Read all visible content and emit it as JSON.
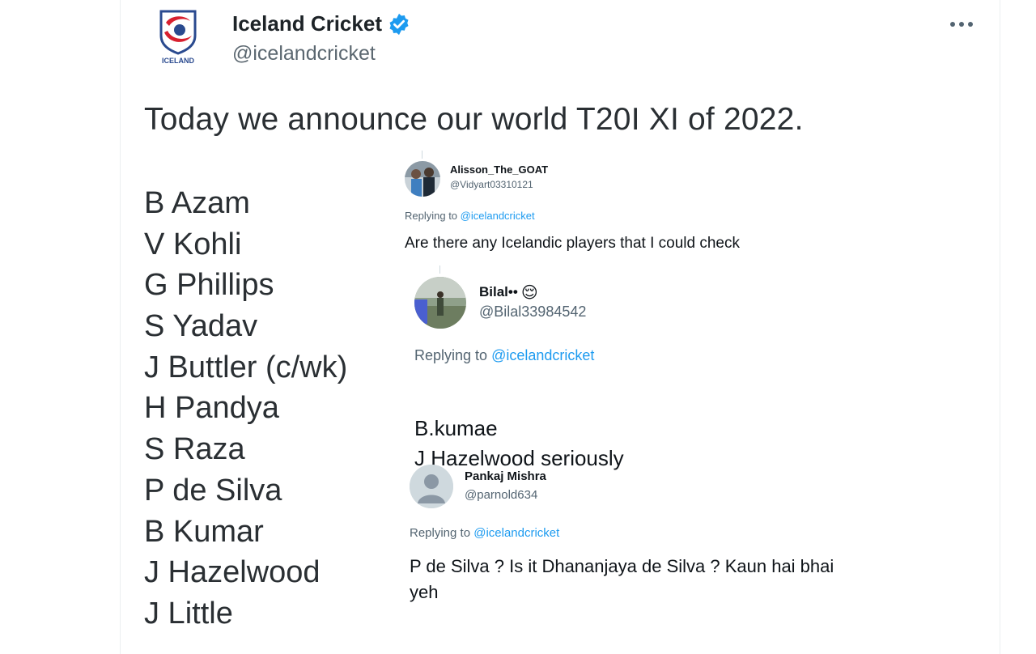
{
  "tweet": {
    "display_name": "Iceland Cricket",
    "handle": "@icelandcricket",
    "logo_text": "ICELAND",
    "text": "Today we announce our world T20I XI of 2022.",
    "players": [
      "B Azam",
      "V Kohli",
      "G Phillips",
      "S Yadav",
      "J Buttler (c/wk)",
      "H Pandya",
      "S Raza",
      "P de Silva",
      "B Kumar",
      "J Hazelwood",
      "J Little"
    ]
  },
  "replies": [
    {
      "name": "Alisson_The_GOAT",
      "handle": "@Vidyart03310121",
      "replying_prefix": "Replying to ",
      "replying_to": "@icelandcricket",
      "text": "Are there any Icelandic players that I could check"
    },
    {
      "name": "Bilal••",
      "emoji": "😌",
      "handle": "@Bilal33984542",
      "replying_prefix": "Replying to ",
      "replying_to": "@icelandcricket",
      "text": "B.kumae\nJ Hazelwood seriously",
      "text_emoji": "😂"
    },
    {
      "name": "Pankaj Mishra",
      "handle": "@parnold634",
      "replying_prefix": "Replying to ",
      "replying_to": "@icelandcricket",
      "text": "P de Silva ? Is it Dhananjaya de Silva ? Kaun hai bhai\nyeh"
    }
  ],
  "colors": {
    "mention": "#1d9bf0",
    "verified": "#1d9bf0",
    "secondary_text": "#536471"
  }
}
